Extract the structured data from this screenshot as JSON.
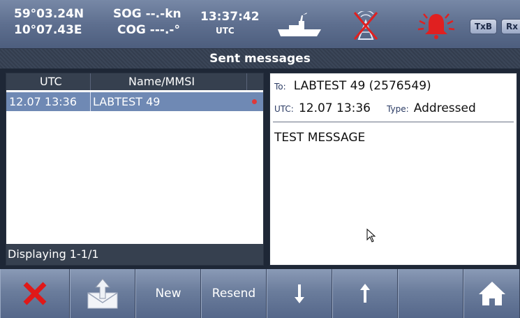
{
  "status": {
    "latitude": "59°03.24N",
    "longitude": "10°07.43E",
    "sog": "SOG --.-kn",
    "cog": "COG ---.-°",
    "time": "13:37:42",
    "time_zone": "UTC",
    "tx_label": "TxB",
    "rx_label": "Rx"
  },
  "title": "Sent messages",
  "list": {
    "headers": [
      "UTC",
      "Name/MMSI"
    ],
    "rows": [
      {
        "utc": "12.07 13:36",
        "name": "LABTEST 49"
      }
    ],
    "footer": "Displaying 1-1/1"
  },
  "detail": {
    "to_label": "To:",
    "to_value": "LABTEST 49 (2576549)",
    "utc_label": "UTC:",
    "utc_value": "12.07 13:36",
    "type_label": "Type:",
    "type_value": "Addressed",
    "body": "TEST MESSAGE"
  },
  "toolbar": {
    "new_label": "New",
    "resend_label": "Resend"
  },
  "icons": {
    "ship": "ship-icon",
    "antenna_disabled": "antenna-off-icon",
    "alarm": "alarm-bell-icon",
    "delete": "delete-x-icon",
    "outbox": "outbox-icon",
    "down": "arrow-down-icon",
    "up": "arrow-up-icon",
    "home": "home-icon"
  },
  "colors": {
    "alarm_red": "#e02020",
    "selected_row": "#6f89b4",
    "delete_red": "#e01818"
  }
}
